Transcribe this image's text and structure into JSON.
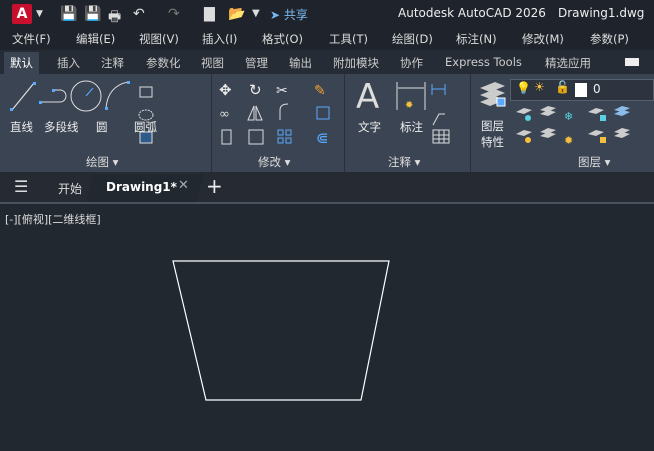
{
  "titlebar": {
    "logo": "A",
    "share": "共享",
    "app_title": "Autodesk AutoCAD 2026",
    "doc_title": "Drawing1.dwg"
  },
  "menus": [
    "文件(F)",
    "编辑(E)",
    "视图(V)",
    "插入(I)",
    "格式(O)",
    "工具(T)",
    "绘图(D)",
    "标注(N)",
    "修改(M)",
    "参数(P)"
  ],
  "ribbon_tabs": [
    "默认",
    "插入",
    "注释",
    "参数化",
    "视图",
    "管理",
    "输出",
    "附加模块",
    "协作",
    "Express Tools",
    "精选应用"
  ],
  "draw_panel": {
    "title": "绘图",
    "tools": [
      "直线",
      "多段线",
      "圆",
      "圆弧"
    ]
  },
  "modify_panel": {
    "title": "修改"
  },
  "annotation_panel": {
    "title": "注释",
    "tools": [
      "文字",
      "标注"
    ]
  },
  "layers_panel": {
    "title": "图层",
    "layer_props": "图层",
    "layer_props2": "特性",
    "current_layer": "0"
  },
  "doc_tabs": {
    "start": "开始",
    "drawing": "Drawing1*"
  },
  "viewport": {
    "label": "[-][俯视][二维线框]"
  }
}
